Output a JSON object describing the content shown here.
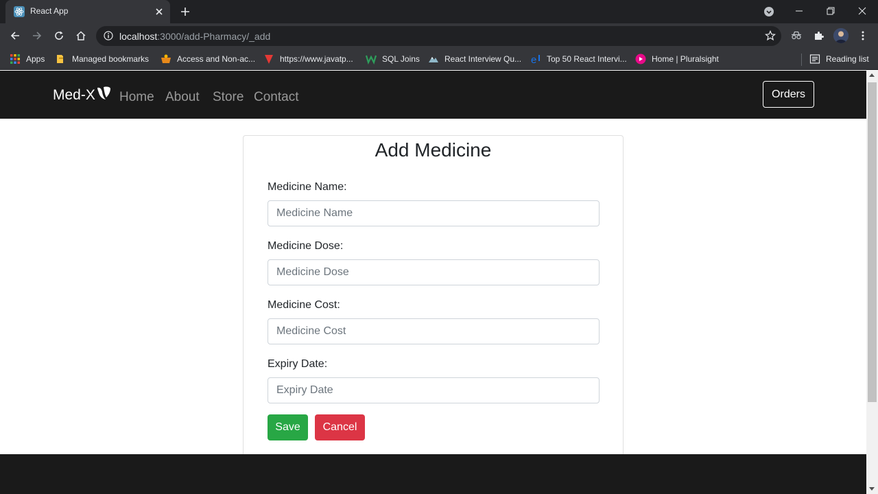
{
  "browser": {
    "tab_title": "React App",
    "url_host": "localhost",
    "url_rest": ":3000/add-Pharmacy/_add",
    "bookmarks": [
      {
        "label": "Apps",
        "icon": "apps-grid-icon"
      },
      {
        "label": "Managed bookmarks",
        "icon": "folder-icon"
      },
      {
        "label": "Access and Non-ac...",
        "icon": "bookmark-favicon"
      },
      {
        "label": "https://www.javatp...",
        "icon": "javatpoint-favicon"
      },
      {
        "label": "SQL Joins",
        "icon": "w3resource-favicon"
      },
      {
        "label": "React Interview Qu...",
        "icon": "mountain-favicon"
      },
      {
        "label": "Top 50 React Intervi...",
        "icon": "edureka-favicon"
      },
      {
        "label": "Home | Pluralsight",
        "icon": "pluralsight-favicon"
      }
    ],
    "reading_list": "Reading list"
  },
  "navbar": {
    "brand": "Med-X",
    "links": [
      "Home",
      "About",
      "Store",
      "Contact"
    ],
    "orders": "Orders"
  },
  "form": {
    "title": "Add Medicine",
    "fields": [
      {
        "label": "Medicine Name:",
        "placeholder": "Medicine Name"
      },
      {
        "label": "Medicine Dose:",
        "placeholder": "Medicine Dose"
      },
      {
        "label": "Medicine Cost:",
        "placeholder": "Medicine Cost"
      },
      {
        "label": "Expiry Date:",
        "placeholder": "Expiry Date"
      }
    ],
    "save": "Save",
    "cancel": "Cancel"
  },
  "colors": {
    "navbar_bg": "#1a1a1a",
    "save_green": "#28a745",
    "cancel_red": "#dc3545",
    "chrome_dark": "#35363a"
  }
}
